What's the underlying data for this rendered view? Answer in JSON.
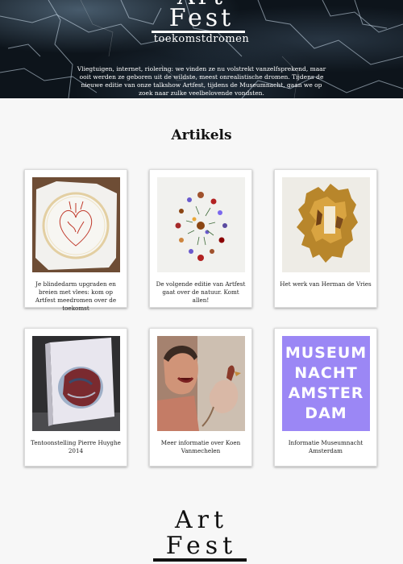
{
  "hero": {
    "logo_line1": "Art",
    "logo_line2": "Fest",
    "subtitle": "toekomstdromen",
    "intro": "Vliegtuigen, internet, riolering: we vinden ze nu volstrekt vanzelfsprekend, maar ooit werden ze geboren uit de wildste, meest onrealistische dromen. Tijdens de nieuwe editie van onze talkshow Artfest, tijdens de Museumnacht, gaan we op zoek naar zulke veelbelovende vondsten."
  },
  "section": {
    "title": "Artikels"
  },
  "cards": [
    {
      "caption": "Je blindedarm upgraden en breien met vlees: kom op Artfest meedromen over de toekomst",
      "image": "embroidered-heart-hoop"
    },
    {
      "caption": "De volgende editie van Artfest gaat over de natuur. Komt allen!",
      "image": "pressed-flowers"
    },
    {
      "caption": "Het werk van Herman de Vries",
      "image": "gold-leaf-artwork"
    },
    {
      "caption": "Tentoonstelling Pierre Huyghe 2014",
      "image": "aquarium-installation"
    },
    {
      "caption": "Meer informatie over Koen Vanmechelen",
      "image": "man-with-rooster"
    },
    {
      "caption": "Informatie Museumnacht Amsterdam",
      "image": "museumnacht-logo",
      "logo_text": [
        "MUSEUM",
        "NACHT",
        "AMSTER",
        "DAM"
      ]
    }
  ],
  "footer": {
    "logo_line1": "Art",
    "logo_line2": "Fest"
  },
  "colors": {
    "hero_bg": "#0d141b",
    "museum_purple": "#9b87f5",
    "page_bg": "#f7f7f7"
  }
}
